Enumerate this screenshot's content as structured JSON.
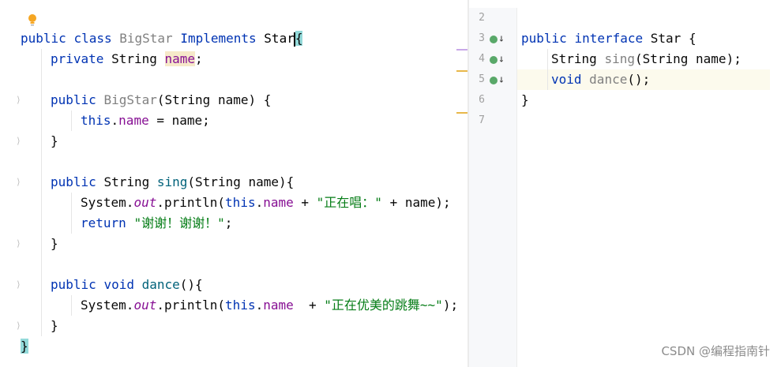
{
  "left_code": {
    "l1": {
      "kw1": "public",
      "kw2": "class",
      "cls": "BigStar",
      "impl": "Implements",
      "iface": "Star",
      "brace": "{"
    },
    "l2": {
      "kw": "private",
      "type": "String",
      "field": "name",
      "end": ";"
    },
    "l4": {
      "kw": "public",
      "name": "BigStar",
      "params": "(String name) {"
    },
    "l5": {
      "kw": "this",
      "dot": ".",
      "field": "name",
      "rest": " = name;"
    },
    "l6": {
      "text": "}"
    },
    "l8": {
      "kw": "public",
      "type": "String",
      "fn": "sing",
      "params": "(String name){"
    },
    "l9": {
      "obj": "System.",
      "out": "out",
      "mid": ".println(",
      "this": "this",
      "dot": ".",
      "field": "name",
      "op": " + ",
      "str": "\"正在唱：\"",
      "rest": " + name);"
    },
    "l10": {
      "kw": "return",
      "str": "\"谢谢！谢谢！\"",
      "end": ";"
    },
    "l11": {
      "text": "}"
    },
    "l13": {
      "kw1": "public",
      "kw2": "void",
      "fn": "dance",
      "params": "(){"
    },
    "l14": {
      "obj": "System.",
      "out": "out",
      "mid": ".println(",
      "this": "this",
      "dot": ".",
      "field": "name",
      "op": "  + ",
      "str": "\"正在优美的跳舞~~\"",
      "rest": ");"
    },
    "l15": {
      "text": "}"
    },
    "l16": {
      "text": "}"
    }
  },
  "gutter": {
    "line_numbers": [
      "2",
      "3",
      "4",
      "5",
      "6",
      "7"
    ]
  },
  "right_code": {
    "r3": {
      "kw1": "public",
      "kw2": "interface",
      "name": "Star",
      "brace": " {"
    },
    "r4": {
      "type": "String",
      "fn": "sing",
      "params": "(String name);"
    },
    "r5": {
      "kw": "void",
      "fn": "dance",
      "params": "();"
    },
    "r6": {
      "text": "}"
    }
  },
  "watermark": "CSDN @编程指南针",
  "colors": {
    "keyword": "#0033b3",
    "field": "#871094",
    "string": "#067d17",
    "function": "#00627a"
  }
}
